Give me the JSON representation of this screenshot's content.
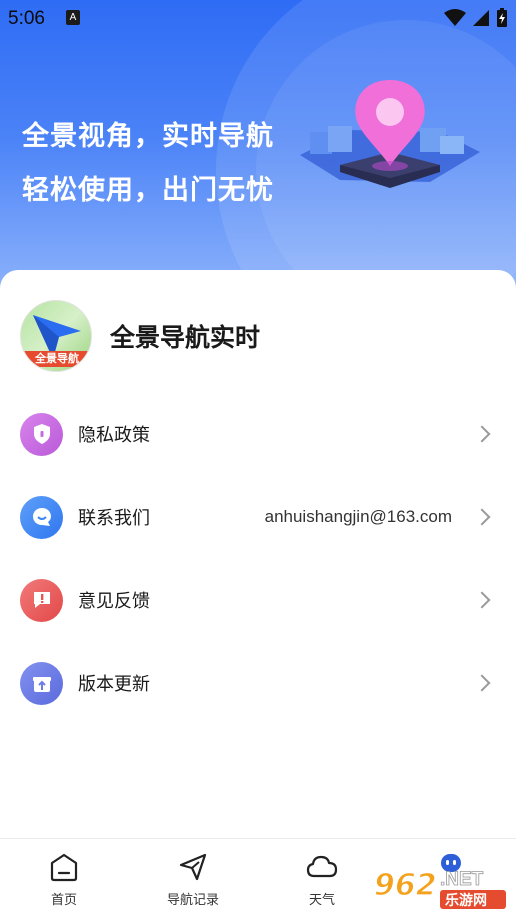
{
  "status_bar": {
    "time": "5:06",
    "a_badge": "A"
  },
  "hero": {
    "line1": "全景视角，实时导航",
    "line2": "轻松使用，出门无忧"
  },
  "profile": {
    "app_name": "全景导航实时",
    "avatar_ribbon": "全景导航"
  },
  "menu": [
    {
      "label": "隐私政策",
      "value": "",
      "icon": "shield-icon",
      "color": "#c86be0"
    },
    {
      "label": "联系我们",
      "value": "anhuishangjin@163.com",
      "icon": "chat-icon",
      "color": "#3f8af5"
    },
    {
      "label": "意见反馈",
      "value": "",
      "icon": "feedback-icon",
      "color": "#ea5858"
    },
    {
      "label": "版本更新",
      "value": "",
      "icon": "gift-icon",
      "color": "#6d7de8"
    }
  ],
  "tabs": [
    {
      "label": "首页",
      "icon": "home-icon"
    },
    {
      "label": "导航记录",
      "icon": "navigation-icon"
    },
    {
      "label": "天气",
      "icon": "cloud-icon"
    },
    {
      "label": "",
      "icon": "profile-icon"
    }
  ],
  "watermark": {
    "number": "962",
    "net": ".NET",
    "site": "乐游网"
  }
}
